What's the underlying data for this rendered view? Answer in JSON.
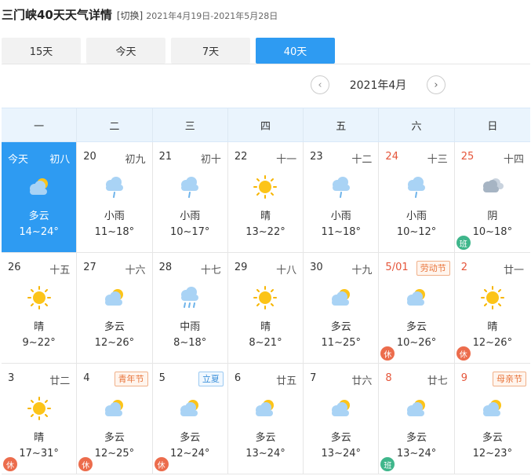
{
  "header": {
    "title": "三门峡40天天气详情",
    "switch_label": "[切换]",
    "date_range": "2021年4月19日-2021年5月28日"
  },
  "tabs": [
    {
      "label": "15天",
      "active": false
    },
    {
      "label": "今天",
      "active": false
    },
    {
      "label": "7天",
      "active": false
    },
    {
      "label": "40天",
      "active": true
    }
  ],
  "month_nav": {
    "prev": "‹",
    "month": "2021年4月",
    "next": "›"
  },
  "weekdays": [
    "一",
    "二",
    "三",
    "四",
    "五",
    "六",
    "日"
  ],
  "colors": {
    "accent": "#2e9bf2",
    "holiday_red": "#e5553a",
    "rest_badge": "#ec6c4c",
    "work_badge": "#3fb68b"
  },
  "days": [
    {
      "day": "今天",
      "lunar": "初八",
      "icon": "partly-cloudy-icon",
      "cond": "多云",
      "temp": "14~24°",
      "today": true
    },
    {
      "day": "20",
      "lunar": "初九",
      "icon": "light-rain-icon",
      "cond": "小雨",
      "temp": "11~18°"
    },
    {
      "day": "21",
      "lunar": "初十",
      "icon": "light-rain-icon",
      "cond": "小雨",
      "temp": "10~17°"
    },
    {
      "day": "22",
      "lunar": "十一",
      "icon": "sun-icon",
      "cond": "晴",
      "temp": "13~22°"
    },
    {
      "day": "23",
      "lunar": "十二",
      "icon": "light-rain-icon",
      "cond": "小雨",
      "temp": "11~18°"
    },
    {
      "day": "24",
      "lunar": "十三",
      "icon": "light-rain-icon",
      "cond": "小雨",
      "temp": "10~12°",
      "red": true
    },
    {
      "day": "25",
      "lunar": "十四",
      "icon": "overcast-icon",
      "cond": "阴",
      "temp": "10~18°",
      "red": true,
      "badge": "班"
    },
    {
      "day": "26",
      "lunar": "十五",
      "icon": "sun-icon",
      "cond": "晴",
      "temp": "9~22°"
    },
    {
      "day": "27",
      "lunar": "十六",
      "icon": "partly-cloudy-icon",
      "cond": "多云",
      "temp": "12~26°"
    },
    {
      "day": "28",
      "lunar": "十七",
      "icon": "moderate-rain-icon",
      "cond": "中雨",
      "temp": "8~18°"
    },
    {
      "day": "29",
      "lunar": "十八",
      "icon": "sun-icon",
      "cond": "晴",
      "temp": "8~21°"
    },
    {
      "day": "30",
      "lunar": "十九",
      "icon": "partly-cloudy-icon",
      "cond": "多云",
      "temp": "11~25°"
    },
    {
      "day": "5/01",
      "festival": "劳动节",
      "icon": "partly-cloudy-icon",
      "cond": "多云",
      "temp": "10~26°",
      "red": true,
      "badge": "休"
    },
    {
      "day": "2",
      "lunar": "廿一",
      "icon": "sun-icon",
      "cond": "晴",
      "temp": "12~26°",
      "red": true,
      "badge": "休"
    },
    {
      "day": "3",
      "lunar": "廿二",
      "icon": "sun-icon",
      "cond": "晴",
      "temp": "17~31°",
      "badge": "休"
    },
    {
      "day": "4",
      "festival": "青年节",
      "icon": "partly-cloudy-icon",
      "cond": "多云",
      "temp": "12~25°",
      "badge": "休"
    },
    {
      "day": "5",
      "festival": "立夏",
      "festival_style": "blue",
      "icon": "partly-cloudy-icon",
      "cond": "多云",
      "temp": "12~24°",
      "badge": "休"
    },
    {
      "day": "6",
      "lunar": "廿五",
      "icon": "partly-cloudy-icon",
      "cond": "多云",
      "temp": "13~24°"
    },
    {
      "day": "7",
      "lunar": "廿六",
      "icon": "partly-cloudy-icon",
      "cond": "多云",
      "temp": "13~24°"
    },
    {
      "day": "8",
      "lunar": "廿七",
      "icon": "partly-cloudy-icon",
      "cond": "多云",
      "temp": "13~24°",
      "red": true,
      "badge": "班"
    },
    {
      "day": "9",
      "festival": "母亲节",
      "icon": "partly-cloudy-icon",
      "cond": "多云",
      "temp": "12~23°",
      "red": true
    }
  ]
}
